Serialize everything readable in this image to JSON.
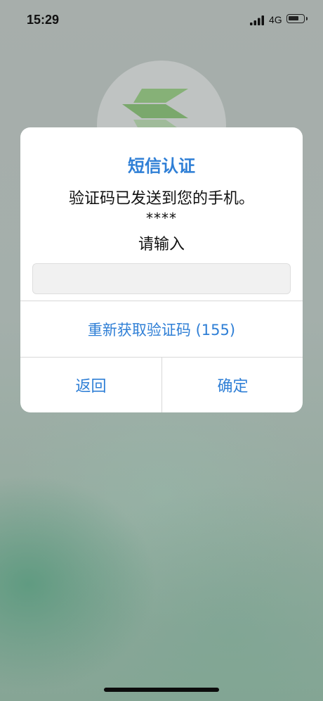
{
  "status_bar": {
    "time": "15:29",
    "network": "4G",
    "icons": [
      "signal-bars-icon",
      "battery-icon"
    ]
  },
  "background": {
    "logo_icon": "app-logo-icon"
  },
  "dialog": {
    "title": "短信认证",
    "message": "验证码已发送到您的手机。",
    "masked_phone": "****",
    "prompt": "请输入",
    "input_value": "",
    "input_placeholder": "",
    "resend_label": "重新获取验证码 (155)",
    "back_label": "返回",
    "confirm_label": "确定"
  },
  "colors": {
    "accent": "#2f7fd6",
    "dialog_bg": "#ffffff",
    "input_bg": "#f1f1f1",
    "divider": "#d8d8d8"
  }
}
